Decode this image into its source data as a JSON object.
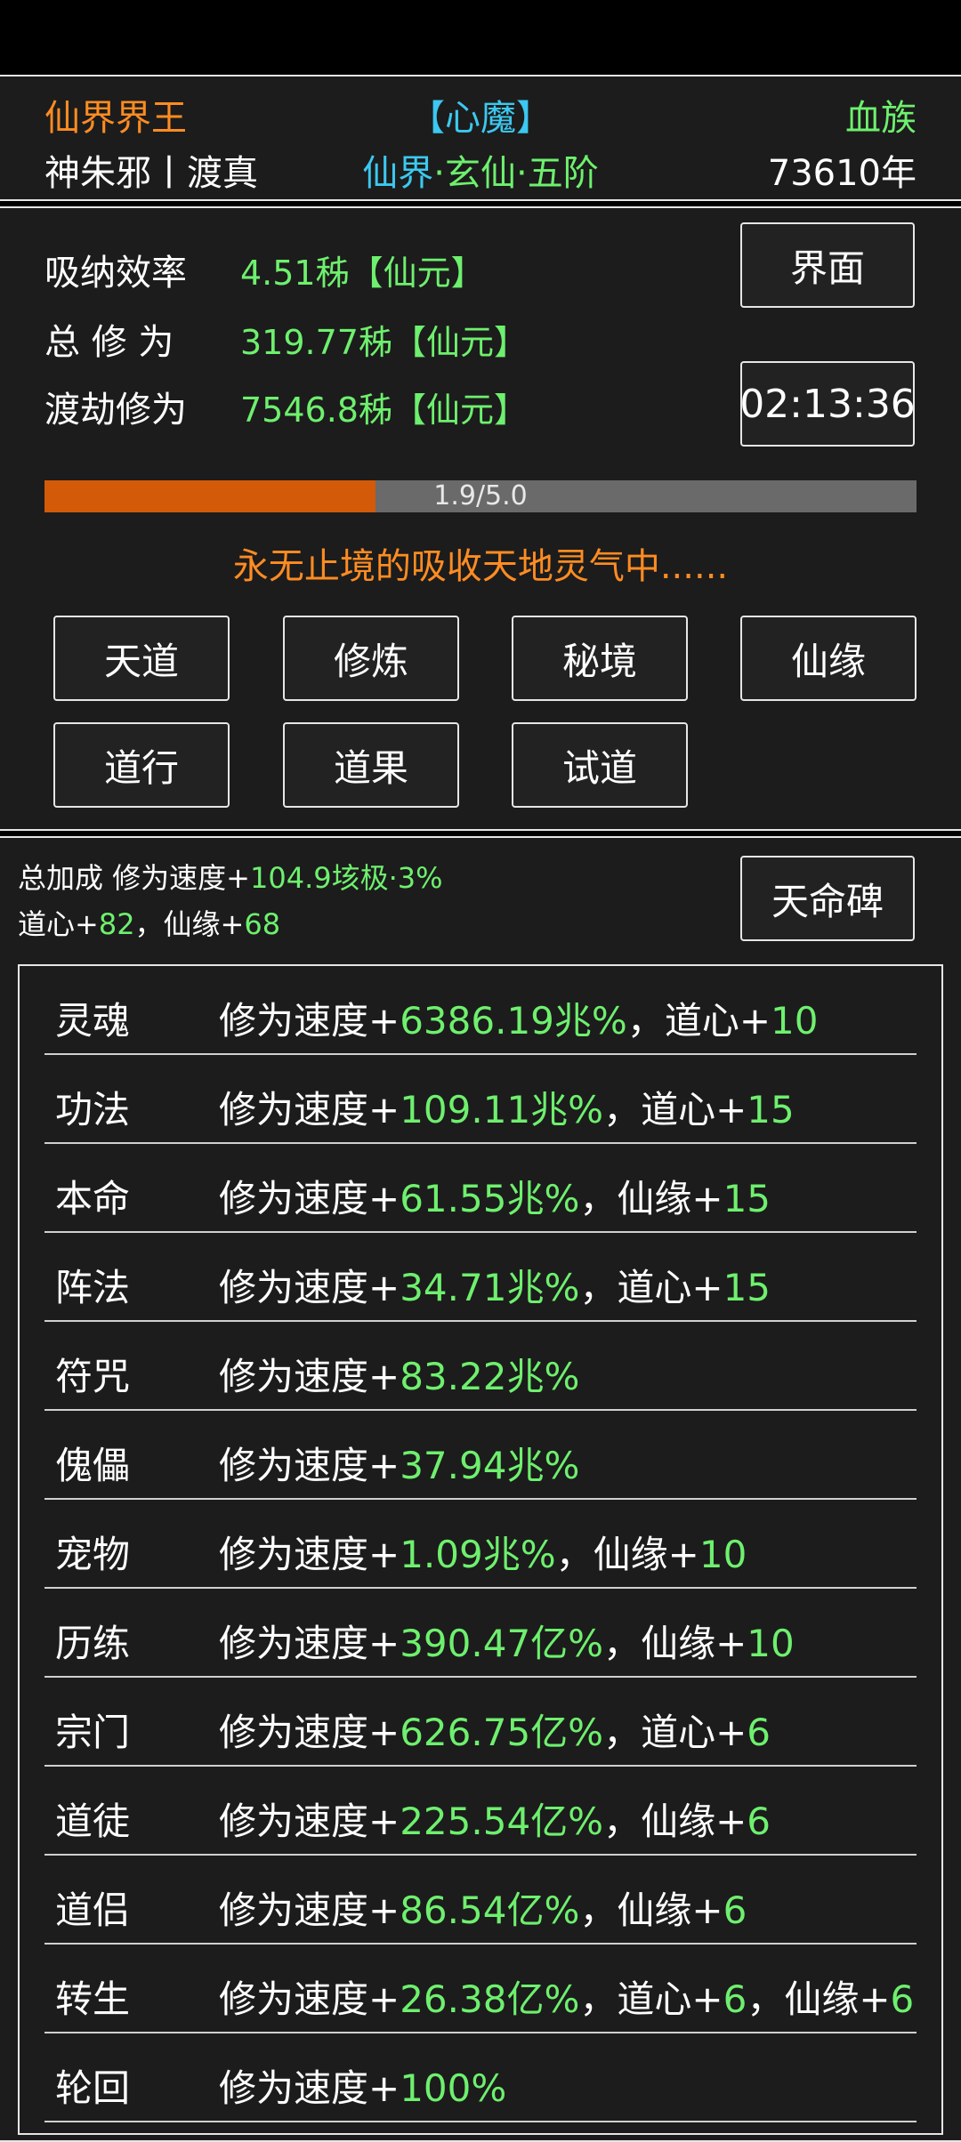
{
  "header": {
    "title": "仙界界王",
    "state": "【心魔】",
    "race": "血族",
    "player": "神朱邪丨渡真",
    "realm": {
      "a": "仙界",
      "dot": "·",
      "b": "玄仙",
      "c": "五阶"
    },
    "years": "73610年"
  },
  "stats": {
    "absorb_label": "吸纳效率",
    "absorb_value": "4.51秭【仙元】",
    "total_label": "总 修 为",
    "total_value": "319.77秭【仙元】",
    "tribulation_label": "渡劫修为",
    "tribulation_value": "7546.8秭【仙元】",
    "interface_button": "界面",
    "timer": "02:13:36"
  },
  "progress": {
    "text": "1.9/5.0",
    "fraction": 0.38
  },
  "status_message": "永无止境的吸收天地灵气中......",
  "menu": [
    "天道",
    "修炼",
    "秘境",
    "仙缘",
    "道行",
    "道果",
    "试道"
  ],
  "bonus": {
    "line1_prefix": "总加成 修为速度+",
    "line1_value": "104.9垓极·3%",
    "line2_a": "道心+",
    "line2_a_value": "82",
    "line2_sep": "，仙缘+",
    "line2_b_value": "68",
    "fate_button": "天命碑"
  },
  "rows": [
    {
      "name": "灵魂",
      "prefix": "修为速度+",
      "value": "6386.19兆%",
      "extras": [
        {
          "label": "道心+",
          "value": "10"
        }
      ]
    },
    {
      "name": "功法",
      "prefix": "修为速度+",
      "value": "109.11兆%",
      "extras": [
        {
          "label": "道心+",
          "value": "15"
        }
      ]
    },
    {
      "name": "本命",
      "prefix": "修为速度+",
      "value": "61.55兆%",
      "extras": [
        {
          "label": "仙缘+",
          "value": "15"
        }
      ]
    },
    {
      "name": "阵法",
      "prefix": "修为速度+",
      "value": "34.71兆%",
      "extras": [
        {
          "label": "道心+",
          "value": "15"
        }
      ]
    },
    {
      "name": "符咒",
      "prefix": "修为速度+",
      "value": "83.22兆%",
      "extras": []
    },
    {
      "name": "傀儡",
      "prefix": "修为速度+",
      "value": "37.94兆%",
      "extras": []
    },
    {
      "name": "宠物",
      "prefix": "修为速度+",
      "value": "1.09兆%",
      "extras": [
        {
          "label": "仙缘+",
          "value": "10"
        }
      ]
    },
    {
      "name": "历练",
      "prefix": "修为速度+",
      "value": "390.47亿%",
      "extras": [
        {
          "label": "仙缘+",
          "value": "10"
        }
      ]
    },
    {
      "name": "宗门",
      "prefix": "修为速度+",
      "value": "626.75亿%",
      "extras": [
        {
          "label": "道心+",
          "value": "6"
        }
      ]
    },
    {
      "name": "道徒",
      "prefix": "修为速度+",
      "value": "225.54亿%",
      "extras": [
        {
          "label": "仙缘+",
          "value": "6"
        }
      ]
    },
    {
      "name": "道侣",
      "prefix": "修为速度+",
      "value": "86.54亿%",
      "extras": [
        {
          "label": "仙缘+",
          "value": "6"
        }
      ]
    },
    {
      "name": "转生",
      "prefix": "修为速度+",
      "value": "26.38亿%",
      "extras": [
        {
          "label": "道心+",
          "value": "6"
        },
        {
          "label": "仙缘+",
          "value": "6"
        }
      ]
    },
    {
      "name": "轮回",
      "prefix": "修为速度+",
      "value": "100%",
      "extras": []
    }
  ],
  "colors": {
    "value_green": "#6ef06e",
    "accent_orange": "#ff8c22",
    "accent_cyan": "#3cc8f0",
    "progress_fill": "#d25a08",
    "panel_bg": "#1c1c1c"
  }
}
